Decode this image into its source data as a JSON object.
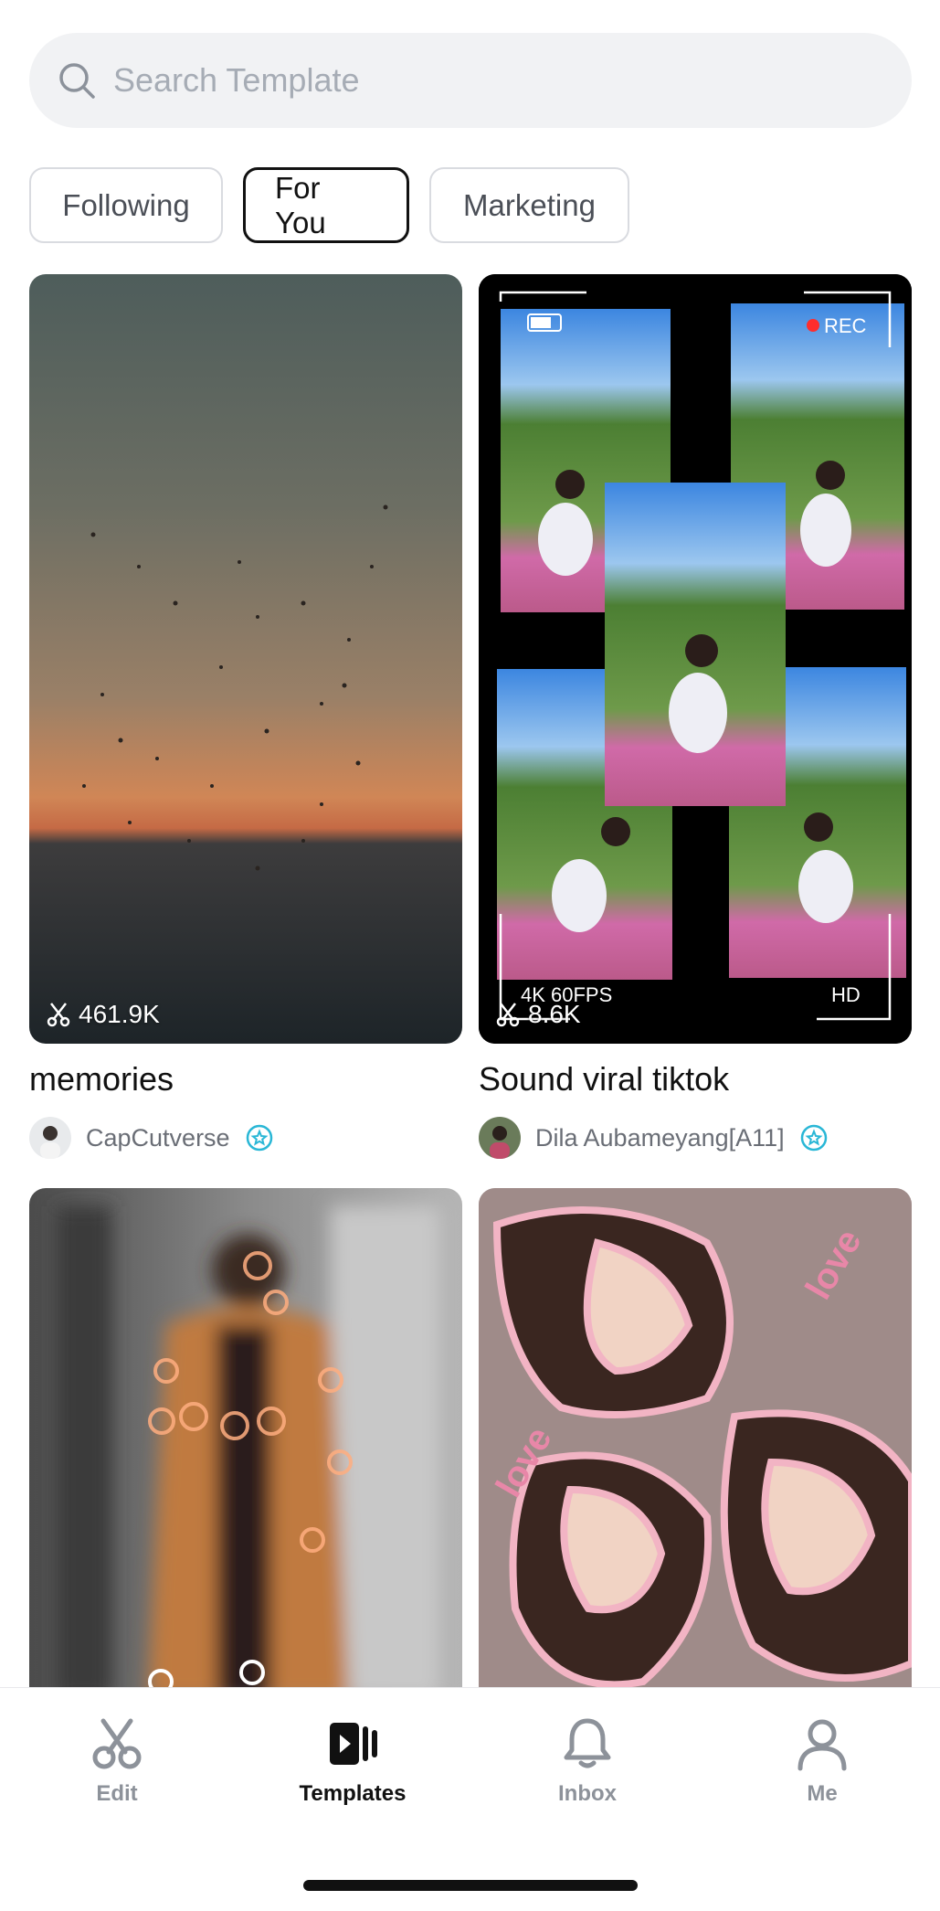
{
  "search": {
    "placeholder": "Search Template"
  },
  "filters": [
    "Following",
    "For You",
    "Marketing"
  ],
  "active_filter": "For You",
  "cards": [
    {
      "title": "memories",
      "uses": "461.9K",
      "author": "CapCutverse",
      "verified": true
    },
    {
      "title": "Sound viral tiktok",
      "uses": "8.6K",
      "author": "Dila Aubameyang[A11]",
      "verified": true,
      "overlay": {
        "rec": "REC",
        "res": "4K 60FPS",
        "hd": "HD"
      }
    },
    {
      "title": "",
      "uses": "",
      "author": ""
    },
    {
      "title": "",
      "uses": "",
      "author": ""
    }
  ],
  "tabs": [
    {
      "label": "Edit",
      "icon": "scissors-icon"
    },
    {
      "label": "Templates",
      "icon": "templates-icon",
      "active": true
    },
    {
      "label": "Inbox",
      "icon": "bell-icon"
    },
    {
      "label": "Me",
      "icon": "person-icon"
    }
  ],
  "colors": {
    "verified_badge": "#2ab7d6",
    "rec_dot": "#ff2d2d"
  }
}
